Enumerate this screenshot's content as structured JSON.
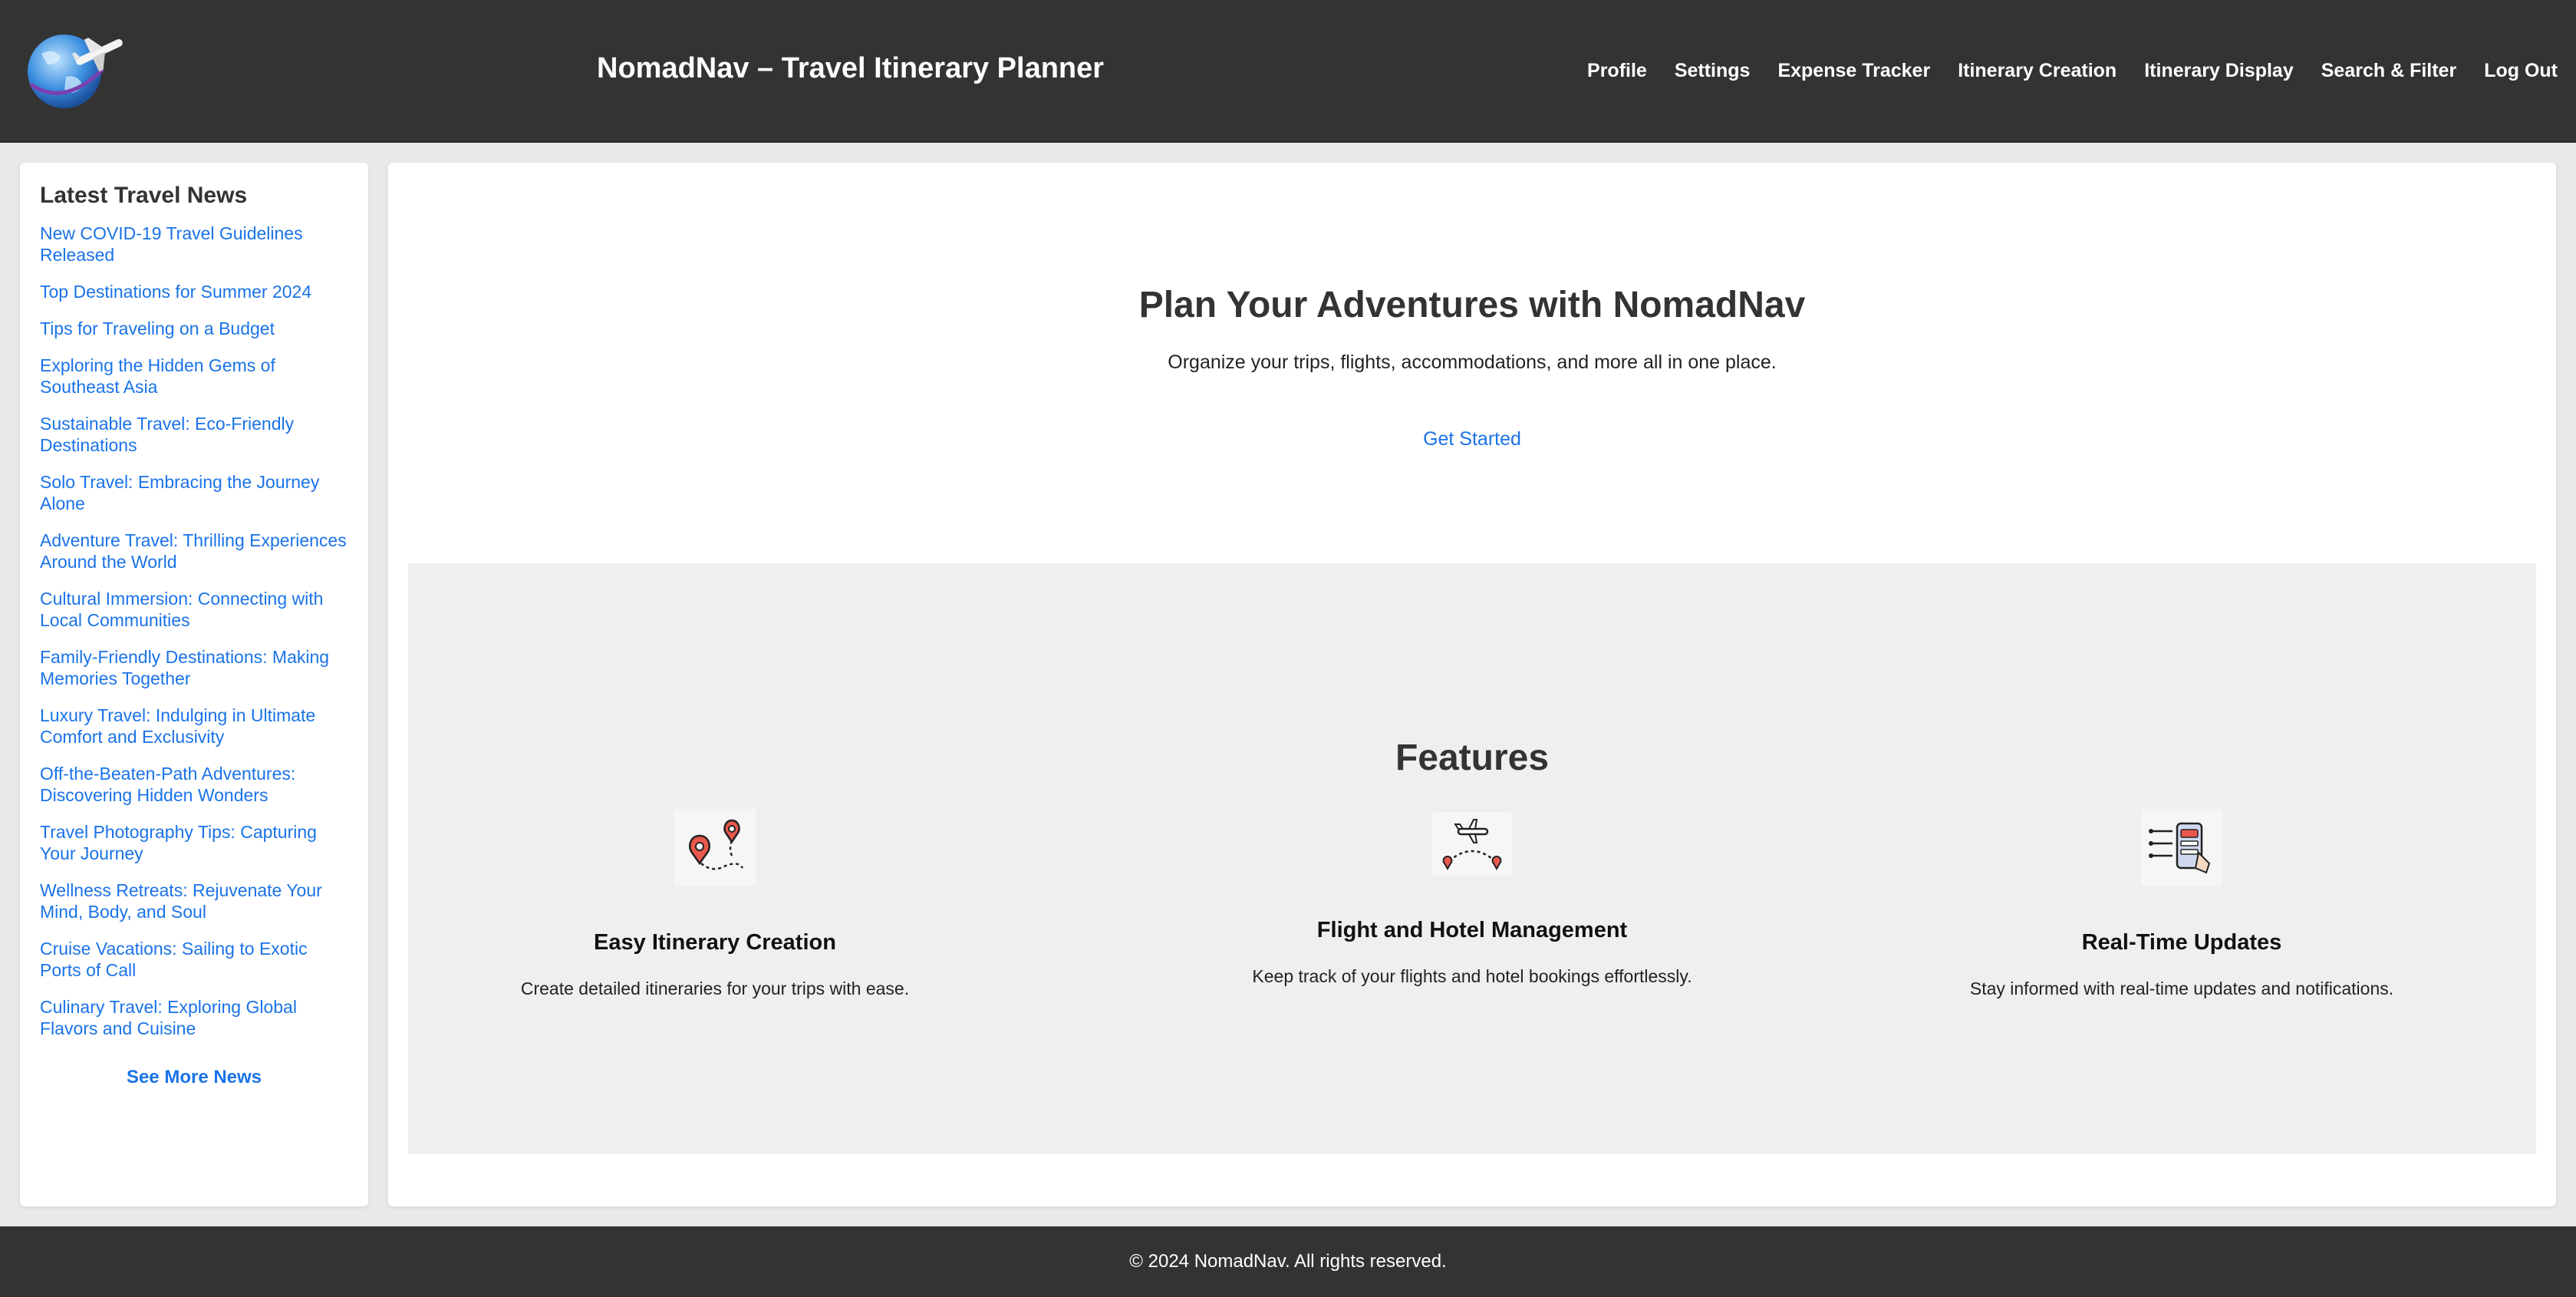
{
  "header": {
    "title": "NomadNav – Travel Itinerary Planner",
    "logo_icon": "globe-airplane-icon",
    "nav": [
      {
        "label": "Profile"
      },
      {
        "label": "Settings"
      },
      {
        "label": "Expense Tracker"
      },
      {
        "label": "Itinerary Creation"
      },
      {
        "label": "Itinerary Display"
      },
      {
        "label": "Search & Filter"
      },
      {
        "label": "Log Out"
      }
    ]
  },
  "sidebar": {
    "heading": "Latest Travel News",
    "items": [
      {
        "label": "New COVID-19 Travel Guidelines Released"
      },
      {
        "label": "Top Destinations for Summer 2024"
      },
      {
        "label": "Tips for Traveling on a Budget"
      },
      {
        "label": "Exploring the Hidden Gems of Southeast Asia"
      },
      {
        "label": "Sustainable Travel: Eco-Friendly Destinations"
      },
      {
        "label": "Solo Travel: Embracing the Journey Alone"
      },
      {
        "label": "Adventure Travel: Thrilling Experiences Around the World"
      },
      {
        "label": "Cultural Immersion: Connecting with Local Communities"
      },
      {
        "label": "Family-Friendly Destinations: Making Memories Together"
      },
      {
        "label": "Luxury Travel: Indulging in Ultimate Comfort and Exclusivity"
      },
      {
        "label": "Off-the-Beaten-Path Adventures: Discovering Hidden Wonders"
      },
      {
        "label": "Travel Photography Tips: Capturing Your Journey"
      },
      {
        "label": "Wellness Retreats: Rejuvenate Your Mind, Body, and Soul"
      },
      {
        "label": "Cruise Vacations: Sailing to Exotic Ports of Call"
      },
      {
        "label": "Culinary Travel: Exploring Global Flavors and Cuisine"
      }
    ],
    "see_more": "See More News"
  },
  "hero": {
    "title": "Plan Your Adventures with NomadNav",
    "subtitle": "Organize your trips, flights, accommodations, and more all in one place.",
    "cta": "Get Started"
  },
  "features": {
    "title": "Features",
    "items": [
      {
        "icon": "map-pins-route-icon",
        "title": "Easy Itinerary Creation",
        "description": "Create detailed itineraries for your trips with ease."
      },
      {
        "icon": "airplane-route-icon",
        "title": "Flight and Hotel Management",
        "description": "Keep track of your flights and hotel bookings effortlessly."
      },
      {
        "icon": "mobile-updates-icon",
        "title": "Real-Time Updates",
        "description": "Stay informed with real-time updates and notifications."
      }
    ]
  },
  "footer": {
    "text": "© 2024 NomadNav. All rights reserved."
  },
  "colors": {
    "header_bg": "#333333",
    "link": "#1a73e8",
    "features_bg": "#efefef",
    "page_bg": "#e9e9e9"
  }
}
